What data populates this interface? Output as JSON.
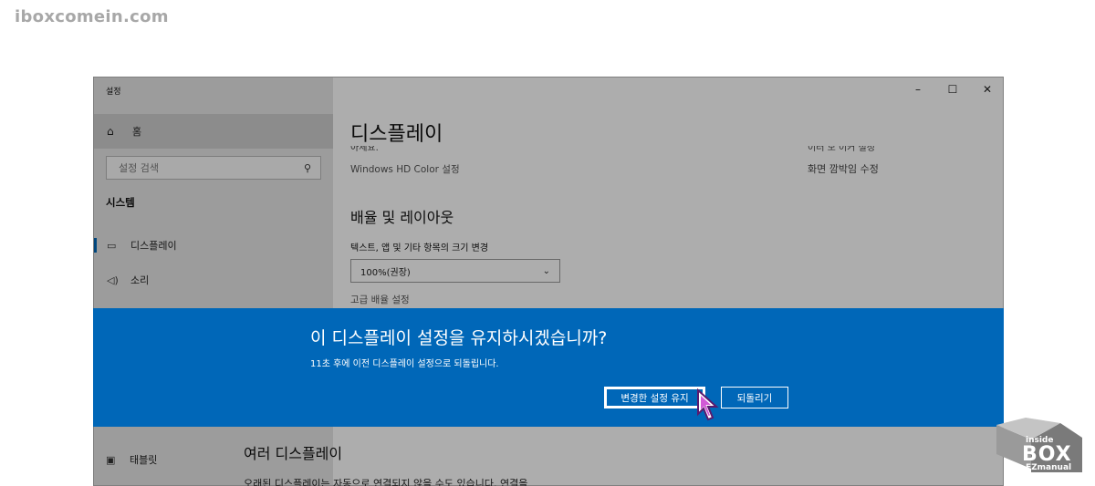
{
  "watermark": "iboxcomein.com",
  "window": {
    "title": "설정",
    "controls": {
      "minimize": "–",
      "maximize": "☐",
      "close": "✕"
    }
  },
  "sidebar": {
    "home_label": "홈",
    "search_placeholder": "설정 검색",
    "section_heading": "시스템",
    "items": [
      {
        "label": "디스플레이",
        "icon": "monitor-icon",
        "active": true
      },
      {
        "label": "소리",
        "icon": "speaker-icon",
        "active": false
      }
    ],
    "tablet_label": "태블릿"
  },
  "content": {
    "page_title": "디스플레이",
    "cut_left": "아세요.",
    "cut_right": "이터 모 이커 절정",
    "hd_color_link": "Windows HD Color 설정",
    "night_light_link": "화면 깜박임 수정",
    "scale_section": "배율 및 레이아웃",
    "scale_label": "텍스트, 앱 및 기타 항목의 크기 변경",
    "scale_value": "100%(권장)",
    "advanced_link": "고급 배율 설정",
    "multi_section": "여러 디스플레이",
    "multi_desc": "오래된 디스플레이는 자동으로 연결되지 않을 수도 있습니다. 연결을"
  },
  "dialog": {
    "title": "이 디스플레이 설정을 유지하시겠습니까?",
    "subtitle": "11초 후에 이전 디스플레이 설정으로 되돌립니다.",
    "keep_button": "변경한 설정 유지",
    "revert_button": "되돌리기",
    "background_color": "#0067b8"
  },
  "logo": {
    "top": "inside",
    "main": "BOX",
    "bottom": "EZmanual"
  }
}
